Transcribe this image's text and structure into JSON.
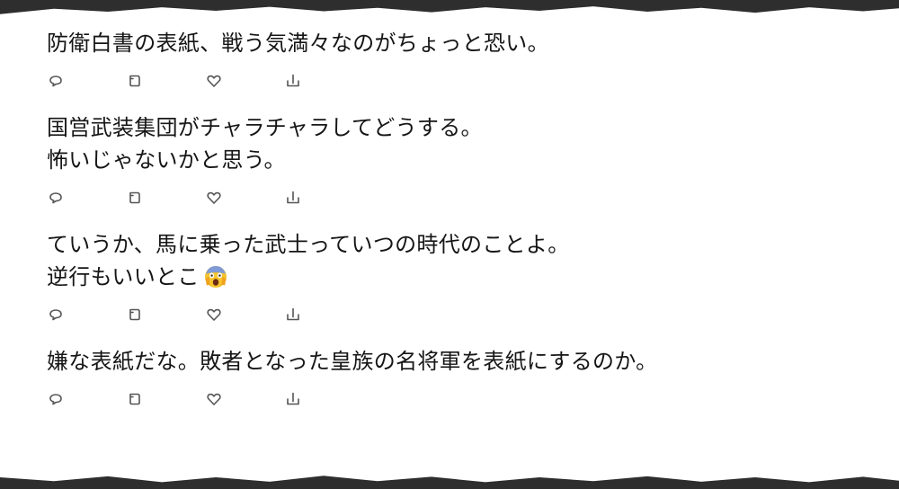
{
  "tweets": [
    {
      "text": "防衛白書の表紙、戦う気満々なのがちょっと恐い。",
      "has_emoji": false,
      "actions": [
        "reply-icon",
        "retweet-icon",
        "like-icon",
        "share-icon"
      ]
    },
    {
      "text": "国営武装集団がチャラチャラしてどうする。\n怖いじゃないかと思う。",
      "has_emoji": false,
      "actions": [
        "reply-icon",
        "retweet-icon",
        "like-icon",
        "share-icon"
      ]
    },
    {
      "text": "ていうか、馬に乗った武士っていつの時代のことよ。\n逆行もいいとこ",
      "has_emoji": true,
      "emoji": "screaming-face-emoji",
      "actions": [
        "reply-icon",
        "retweet-icon",
        "like-icon",
        "share-icon"
      ]
    },
    {
      "text": "嫌な表紙だな。敗者となった皇族の名将軍を表紙にするのか。",
      "has_emoji": false,
      "actions": [
        "reply-icon",
        "retweet-icon",
        "like-icon",
        "share-icon"
      ]
    }
  ],
  "colors": {
    "text": "#161616",
    "icon": "#555555",
    "background": "#ffffff",
    "frame": "#2e2e2e"
  }
}
